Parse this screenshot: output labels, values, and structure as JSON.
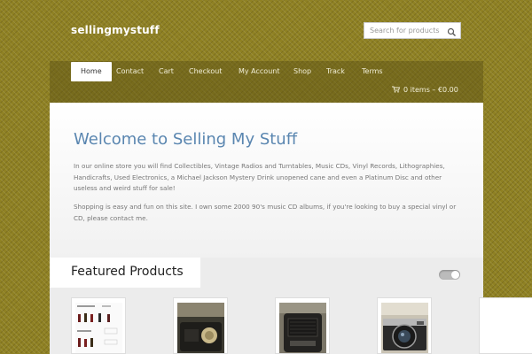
{
  "header": {
    "site_title": "sellingmystuff",
    "search_placeholder": "Search for products"
  },
  "nav": {
    "items": [
      {
        "label": "Home",
        "active": true
      },
      {
        "label": "Contact"
      },
      {
        "label": "Cart"
      },
      {
        "label": "Checkout"
      },
      {
        "label": "My Account"
      },
      {
        "label": "Shop"
      },
      {
        "label": "Track"
      },
      {
        "label": "Terms"
      }
    ],
    "cart": "0 items – €0.00"
  },
  "welcome": {
    "title": "Welcome to Selling My Stuff",
    "paragraph1": "In our online store you will find Collectibles, Vintage Radios and Turntables, Music CDs, Vinyl Records, Lithographies, Handicrafts, Used Electronics, a Michael Jackson Mystery Drink unopened cane and even a Platinum Disc and other useless and weird stuff for sale!",
    "paragraph2": "Shopping is easy and fun on this site. I own some 2000 90's music CD albums, if you're looking to buy a special vinyl or CD, please contact me."
  },
  "featured": {
    "title": "Featured Products"
  },
  "colors": {
    "background": "#8f8123",
    "title_blue": "#5a86b0"
  }
}
